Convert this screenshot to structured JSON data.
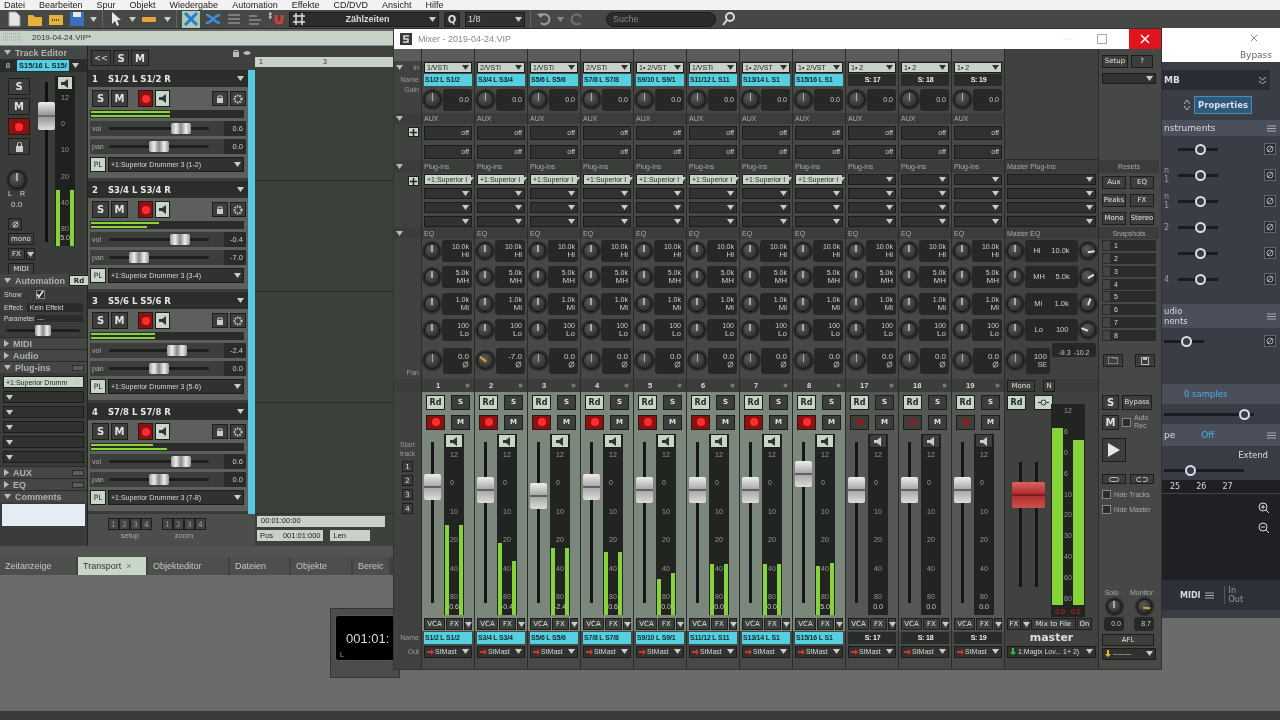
{
  "menu": [
    "Datei",
    "Bearbeiten",
    "Spur",
    "Objekt",
    "Wiedergabe",
    "Automation",
    "Effekte",
    "CD/DVD",
    "Ansicht",
    "Hilfe"
  ],
  "toolbar": {
    "snap": "Zählzeiten",
    "quantize": "Q",
    "grid": "1/8",
    "search_placeholder": "Suche"
  },
  "project_tab": "2019-04-24.VIP*",
  "track_editor": {
    "title": "Track Editor",
    "number": "8",
    "name": "S15/16 L S15/",
    "solo": "S",
    "mute": "M",
    "armed": true,
    "fader": {
      "level": 0.85
    },
    "meter_scale": [
      "12",
      "0",
      "10",
      "20",
      "40",
      "80"
    ],
    "meters": [
      {
        "level": 0.33
      },
      {
        "level": 0.33
      }
    ],
    "volume": "5.0",
    "pan_left": "L",
    "pan_right": "R",
    "pan": "0.0",
    "mono": "mono",
    "fx": "FX",
    "midi": "MIDI",
    "automation": {
      "title": "Automation",
      "mode": "Rd",
      "show_label": "Show",
      "show": true,
      "effect_label": "Effect:",
      "effect": "Kein Effekt",
      "parameter_label": "Parameter",
      "parameter": "---",
      "slider": {
        "level": 0.5
      }
    },
    "sections": [
      {
        "kind": "plain",
        "title": "MIDI",
        "expanded": false
      },
      {
        "kind": "plain",
        "title": "Audio",
        "expanded": false
      },
      {
        "kind": "plugins",
        "title": "Plug-ins",
        "expanded": true,
        "on": false,
        "slots": [
          "+1:Superior Drumm"
        ]
      },
      {
        "kind": "plain",
        "title": "AUX",
        "expanded": false,
        "on": false
      },
      {
        "kind": "plain",
        "title": "EQ",
        "expanded": false,
        "on": false
      },
      {
        "kind": "comments",
        "title": "Comments",
        "expanded": true
      }
    ]
  },
  "tracklist": {
    "collapse": "<<",
    "solo": "S",
    "mute": "M",
    "ruler": [
      "1",
      "3"
    ],
    "tracks": [
      {
        "number": "1",
        "name": "S1/2 L S1/2 R",
        "solo": "S",
        "mute": "M",
        "armed": true,
        "meters": [
          {
            "level": 0.52
          },
          {
            "level": 0.52
          }
        ],
        "volume_label": "vol",
        "volume_slider": {
          "level": 0.78
        },
        "volume": "0.6",
        "pan_label": "pan",
        "pan_slider": {
          "level": 0.5
        },
        "pan": "0.0",
        "plugin_label": "PL",
        "plugin": "+1:Superior Drummer 3 (1-2)"
      },
      {
        "number": "2",
        "name": "S3/4 L S3/4 R",
        "solo": "S",
        "mute": "M",
        "armed": true,
        "meters": [
          {
            "level": 0.45
          },
          {
            "level": 0.37
          }
        ],
        "volume_label": "vol",
        "volume_slider": {
          "level": 0.76
        },
        "volume": "-0.4",
        "pan_label": "pan",
        "pan_slider": {
          "level": 0.25
        },
        "pan": "-7.0",
        "plugin_label": "PL",
        "plugin": "+1:Superior Drummer 3 (3-4)"
      },
      {
        "number": "3",
        "name": "S5/6 L S5/6 R",
        "solo": "S",
        "mute": "M",
        "armed": true,
        "meters": [
          {
            "level": 0.42
          },
          {
            "level": 0.42
          }
        ],
        "volume_label": "vol",
        "volume_slider": {
          "level": 0.72
        },
        "volume": "-2.4",
        "pan_label": "pan",
        "pan_slider": {
          "level": 0.5
        },
        "pan": "0.0",
        "plugin_label": "PL",
        "plugin": "+1:Superior Drummer 3 (5-6)"
      },
      {
        "number": "4",
        "name": "S7/8 L S7/8 R",
        "solo": "S",
        "mute": "M",
        "armed": true,
        "meters": [
          {
            "level": 0.41
          },
          {
            "level": 0.5
          }
        ],
        "volume_label": "vol",
        "volume_slider": {
          "level": 0.78
        },
        "volume": "0.6",
        "pan_label": "pan",
        "pan_slider": {
          "level": 0.5
        },
        "pan": "0.0",
        "plugin_label": "PL",
        "plugin": "+1:Superior Drummer 3 (7-8)"
      }
    ],
    "setup_buttons": [
      "1",
      "2",
      "3",
      "4"
    ],
    "setup_label": "setup",
    "zoom_buttons": [
      "1",
      "2",
      "3",
      "4"
    ],
    "zoom_label": "zoom",
    "timecode": "00:01:00:00",
    "pos_label": "Pos",
    "pos": "001:01:000",
    "len_label": "Len"
  },
  "bottom_tabs": [
    {
      "label": "Zeitanzeige",
      "selected": false
    },
    {
      "label": "Transport",
      "selected": true,
      "close": "×"
    },
    {
      "label": "Objekteditor",
      "selected": false
    },
    {
      "label": "Dateien",
      "selected": false
    },
    {
      "label": "Objekte",
      "selected": false
    },
    {
      "label": "Bereic",
      "selected": false
    }
  ],
  "transport": {
    "time": "001:01:",
    "marker": "L"
  },
  "mixer": {
    "title": "Mixer - 2019-04-24.VIP",
    "labels": {
      "in": "In",
      "name": "Name",
      "gain": "Gain",
      "pan": "Pan",
      "start_track": "Start track",
      "start_tracks": [
        "1",
        "2",
        "3",
        "4"
      ],
      "name_bottom": "Name",
      "out": "Out"
    },
    "channels": [
      {
        "kind": "track",
        "in": "1/VSTi",
        "name": "S1/2 L S1/2",
        "gain": "0.0",
        "aux_header": "AUX",
        "aux": [
          "off",
          "off"
        ],
        "plugins_header": "Plug-ins",
        "plugins": [
          "+1:Superior I"
        ],
        "eq_header": "EQ",
        "eq": [
          [
            "10.0k",
            "Hi"
          ],
          [
            "5.0k",
            "MH"
          ],
          [
            "1.0k",
            "Mi"
          ],
          [
            "100",
            "Lo"
          ]
        ],
        "pan_knob": {
          "level": 0.5
        },
        "pan": "0.0",
        "number": "1",
        "read": "Rd",
        "solo": "S",
        "mute": "M",
        "armed": true,
        "fader": {
          "level": 0.76
        },
        "meter_scale": [
          "12",
          "0",
          "10",
          "20",
          "40",
          "80"
        ],
        "meters": [
          {
            "level": 0.5
          },
          {
            "level": 0.5
          }
        ],
        "volume": "0.6",
        "vca": "VCA",
        "fx": "FX",
        "name_bottom": "S1/2 L S1/2",
        "out": "StMast"
      },
      {
        "kind": "track",
        "in": "2/VSTi",
        "name": "S3/4 L S3/4",
        "gain": "0.0",
        "aux_header": "AUX",
        "aux": [
          "off",
          "off"
        ],
        "plugins_header": "Plug-ins",
        "plugins": [
          "+1:Superior I"
        ],
        "eq_header": "EQ",
        "eq": [
          [
            "10.0k",
            "Hi"
          ],
          [
            "5.0k",
            "MH"
          ],
          [
            "1.0k",
            "Mi"
          ],
          [
            "100",
            "Lo"
          ]
        ],
        "pan_knob": {
          "level": 0.3
        },
        "pan": "-7.0",
        "number": "2",
        "read": "Rd",
        "solo": "S",
        "mute": "M",
        "armed": true,
        "fader": {
          "level": 0.74
        },
        "meter_scale": [
          "12",
          "0",
          "10",
          "20",
          "40",
          "80"
        ],
        "meters": [
          {
            "level": 0.4
          },
          {
            "level": 0.3
          }
        ],
        "volume": "-0.4",
        "vca": "VCA",
        "fx": "FX",
        "name_bottom": "S3/4 L S3/4",
        "out": "StMast"
      },
      {
        "kind": "track",
        "in": "1/VSTi",
        "name": "S5/6 L S5/6",
        "gain": "0.0",
        "aux_header": "AUX",
        "aux": [
          "off",
          "off"
        ],
        "plugins_header": "Plug-ins",
        "plugins": [
          "+1:Superior I"
        ],
        "eq_header": "EQ",
        "eq": [
          [
            "10.0k",
            "Hi"
          ],
          [
            "5.0k",
            "MH"
          ],
          [
            "1.0k",
            "Mi"
          ],
          [
            "100",
            "Lo"
          ]
        ],
        "pan_knob": {
          "level": 0.5
        },
        "pan": "0.0",
        "number": "3",
        "read": "Rd",
        "solo": "S",
        "mute": "M",
        "armed": true,
        "fader": {
          "level": 0.7
        },
        "meter_scale": [
          "12",
          "0",
          "10",
          "20",
          "40",
          "80"
        ],
        "meters": [
          {
            "level": 0.37
          },
          {
            "level": 0.37
          }
        ],
        "volume": "-2.4",
        "vca": "VCA",
        "fx": "FX",
        "name_bottom": "S5/6 L S5/6",
        "out": "StMast"
      },
      {
        "kind": "track",
        "in": "2/VSTi",
        "name": "S7/8 L S7/8",
        "gain": "0.0",
        "aux_header": "AUX",
        "aux": [
          "off",
          "off"
        ],
        "plugins_header": "Plug-ins",
        "plugins": [
          "+1:Superior I"
        ],
        "eq_header": "EQ",
        "eq": [
          [
            "10.0k",
            "Hi"
          ],
          [
            "5.0k",
            "MH"
          ],
          [
            "1.0k",
            "Mi"
          ],
          [
            "100",
            "Lo"
          ]
        ],
        "pan_knob": {
          "level": 0.5
        },
        "pan": "0.0",
        "number": "4",
        "read": "Rd",
        "solo": "S",
        "mute": "M",
        "armed": true,
        "fader": {
          "level": 0.76
        },
        "meter_scale": [
          "12",
          "0",
          "10",
          "20",
          "40",
          "80"
        ],
        "meters": [
          {
            "level": 0.35
          },
          {
            "level": 0.35
          }
        ],
        "volume": "0.6",
        "vca": "VCA",
        "fx": "FX",
        "name_bottom": "S7/8 L S7/8",
        "out": "StMast"
      },
      {
        "kind": "track",
        "in": "1• 2/VST",
        "name": "S9/10 L S9/1",
        "gain": "0.0",
        "aux_header": "AUX",
        "aux": [
          "off",
          "off"
        ],
        "plugins_header": "Plug-ins",
        "plugins": [
          "+1:Superior I"
        ],
        "eq_header": "EQ",
        "eq": [
          [
            "10.0k",
            "Hi"
          ],
          [
            "5.0k",
            "MH"
          ],
          [
            "1.0k",
            "Mi"
          ],
          [
            "100",
            "Lo"
          ]
        ],
        "pan_knob": {
          "level": 0.5
        },
        "pan": "0.0",
        "number": "5",
        "read": "Rd",
        "solo": "S",
        "mute": "M",
        "armed": true,
        "fader": {
          "level": 0.74
        },
        "meter_scale": [
          "12",
          "0",
          "10",
          "20",
          "40",
          "80"
        ],
        "meters": [
          {
            "level": 0.2
          },
          {
            "level": 0.23
          }
        ],
        "volume": "0.0",
        "vca": "VCA",
        "fx": "FX",
        "name_bottom": "S9/10 L S9/1",
        "out": "StMast"
      },
      {
        "kind": "track",
        "in": "1/VSTi",
        "name": "S11/12 L S11",
        "gain": "0.0",
        "aux_header": "AUX",
        "aux": [
          "off",
          "off"
        ],
        "plugins_header": "Plug-ins",
        "plugins": [
          "+1:Superior I"
        ],
        "eq_header": "EQ",
        "eq": [
          [
            "10.0k",
            "Hi"
          ],
          [
            "5.0k",
            "MH"
          ],
          [
            "1.0k",
            "Mi"
          ],
          [
            "100",
            "Lo"
          ]
        ],
        "pan_knob": {
          "level": 0.5
        },
        "pan": "0.0",
        "number": "6",
        "read": "Rd",
        "solo": "S",
        "mute": "M",
        "armed": true,
        "fader": {
          "level": 0.74
        },
        "meter_scale": [
          "12",
          "0",
          "10",
          "20",
          "40",
          "80"
        ],
        "meters": [
          {
            "level": 0.28
          },
          {
            "level": 0.28
          }
        ],
        "volume": "0.0",
        "vca": "VCA",
        "fx": "FX",
        "name_bottom": "S11/12 L S11",
        "out": "StMast"
      },
      {
        "kind": "track",
        "in": "1• 2/VST",
        "name": "S13/14 L S1",
        "gain": "0.0",
        "aux_header": "AUX",
        "aux": [
          "off",
          "off"
        ],
        "plugins_header": "Plug-ins",
        "plugins": [
          "+1:Superior I"
        ],
        "eq_header": "EQ",
        "eq": [
          [
            "10.0k",
            "Hi"
          ],
          [
            "5.0k",
            "MH"
          ],
          [
            "1.0k",
            "Mi"
          ],
          [
            "100",
            "Lo"
          ]
        ],
        "pan_knob": {
          "level": 0.5
        },
        "pan": "0.0",
        "number": "7",
        "read": "Rd",
        "solo": "S",
        "mute": "M",
        "armed": true,
        "fader": {
          "level": 0.74
        },
        "meter_scale": [
          "12",
          "0",
          "10",
          "20",
          "40",
          "80"
        ],
        "meters": [
          {
            "level": 0.28
          },
          {
            "level": 0.28
          }
        ],
        "volume": "0.0",
        "vca": "VCA",
        "fx": "FX",
        "name_bottom": "S13/14 L S1",
        "out": "StMast"
      },
      {
        "kind": "track",
        "in": "1• 2/VST",
        "name": "S15/16 L S1",
        "gain": "0.0",
        "aux_header": "AUX",
        "aux": [
          "off",
          "off"
        ],
        "plugins_header": "Plug-ins",
        "plugins": [
          "+1:Superior I"
        ],
        "eq_header": "EQ",
        "eq": [
          [
            "10.0k",
            "Hi"
          ],
          [
            "5.0k",
            "MH"
          ],
          [
            "1.0k",
            "Mi"
          ],
          [
            "100",
            "Lo"
          ]
        ],
        "pan_knob": {
          "level": 0.5
        },
        "pan": "0.0",
        "number": "8",
        "read": "Rd",
        "solo": "S",
        "mute": "M",
        "armed": true,
        "fader": {
          "level": 0.86
        },
        "meter_scale": [
          "12",
          "0",
          "10",
          "20",
          "40",
          "80"
        ],
        "meters": [
          {
            "level": 0.27
          },
          {
            "level": 0.29
          }
        ],
        "volume": "5.0",
        "vca": "VCA",
        "fx": "FX",
        "name_bottom": "S15/16 L S1",
        "out": "StMast"
      },
      {
        "kind": "submix",
        "in": "1• 2",
        "name": "S: 17",
        "gain": "0.0",
        "aux_header": "AUX",
        "aux": [
          "off",
          "off"
        ],
        "plugins_header": "Plug-ins",
        "eq_header": "EQ",
        "eq": [
          [
            "10.0k",
            "Hi"
          ],
          [
            "5.0k",
            "MH"
          ],
          [
            "1.0k",
            "Mi"
          ],
          [
            "100",
            "Lo"
          ]
        ],
        "pan_knob": {
          "level": 0.5
        },
        "pan": "0.0",
        "number": "17",
        "read": "Rd",
        "solo": "S",
        "mute": "M",
        "armed": false,
        "fader": {
          "level": 0.74
        },
        "meter_scale": [
          "12",
          "0",
          "10",
          "20",
          "40",
          "80"
        ],
        "volume": "0.0",
        "vca": "VCA",
        "fx": "FX",
        "name_bottom": "S: 17",
        "out": "StMast"
      },
      {
        "kind": "submix",
        "in": "1• 2",
        "name": "S: 18",
        "gain": "0.0",
        "aux_header": "AUX",
        "aux": [
          "off",
          "off"
        ],
        "plugins_header": "Plug-ins",
        "eq_header": "EQ",
        "eq": [
          [
            "10.0k",
            "Hi"
          ],
          [
            "5.0k",
            "MH"
          ],
          [
            "1.0k",
            "Mi"
          ],
          [
            "100",
            "Lo"
          ]
        ],
        "pan_knob": {
          "level": 0.5
        },
        "pan": "0.0",
        "number": "18",
        "read": "Rd",
        "solo": "S",
        "mute": "M",
        "armed": false,
        "fader": {
          "level": 0.74
        },
        "meter_scale": [
          "12",
          "0",
          "10",
          "20",
          "40",
          "80"
        ],
        "volume": "0.0",
        "vca": "VCA",
        "fx": "FX",
        "name_bottom": "S: 18",
        "out": "StMast"
      },
      {
        "kind": "submix",
        "in": "1• 2",
        "name": "S: 19",
        "gain": "0.0",
        "aux_header": "AUX",
        "aux": [
          "off",
          "off"
        ],
        "plugins_header": "Plug-ins",
        "eq_header": "EQ",
        "eq": [
          [
            "10.0k",
            "Hi"
          ],
          [
            "5.0k",
            "MH"
          ],
          [
            "1.0k",
            "Mi"
          ],
          [
            "100",
            "Lo"
          ]
        ],
        "pan_knob": {
          "level": 0.5
        },
        "pan": "0.0",
        "number": "19",
        "read": "Rd",
        "solo": "S",
        "mute": "M",
        "armed": false,
        "fader": {
          "level": 0.74
        },
        "meter_scale": [
          "12",
          "0",
          "10",
          "20",
          "40",
          "80"
        ],
        "volume": "0.0",
        "vca": "VCA",
        "fx": "FX",
        "name_bottom": "S: 19",
        "out": "StMast"
      }
    ],
    "master": {
      "plugins_header": "Master Plug-ins",
      "eq_header": "Master EQ",
      "eq": [
        {
          "band": "Hi",
          "freq": "10.0k",
          "gain_knob": {
            "level": 0.8
          }
        },
        {
          "band": "MH",
          "freq": "5.0k",
          "gain_knob": {
            "level": 0.72
          }
        },
        {
          "band": "Mi",
          "freq": "1.0k",
          "gain_knob": {
            "level": 0.58
          }
        },
        {
          "band": "Lo",
          "freq": "100",
          "gain_knob": {
            "level": 0.25
          }
        }
      ],
      "pan": "100",
      "pan_mode": "SE",
      "peaks": [
        "-9.3",
        "-10.2"
      ],
      "mono": "Mono",
      "n": "N",
      "read": "Rd",
      "faders": [
        {
          "level": 0.8
        },
        {
          "level": 0.8
        }
      ],
      "meter_scale": [
        "12",
        "6",
        "0",
        "6",
        "10",
        "20",
        "30",
        "40",
        "60",
        "80"
      ],
      "meters": [
        {
          "level": 0.88
        },
        {
          "level": 0.82
        }
      ],
      "peak_readings": [
        "0.0",
        "0.0"
      ],
      "fx": "FX",
      "mix_to_file": "Mix to File",
      "on": "On",
      "label": "master",
      "out": "1:Magix Lov... 1+ 2)"
    },
    "controls": {
      "setup": "Setup",
      "help": "?",
      "resets_header": "Resets",
      "resets": [
        "Aux",
        "EQ",
        "Peaks",
        "FX",
        "Mono",
        "Stereo"
      ],
      "snapshots_header": "Snapshots",
      "snapshots": [
        "1",
        "2",
        "3",
        "4",
        "5",
        "6",
        "7",
        "8"
      ],
      "solo": "S",
      "bypass": "Bypass",
      "mute": "M",
      "auto_rec": {
        "label": "Auto Rec",
        "checked": false
      },
      "hide_tracks": {
        "label": "hide Tracks",
        "checked": false
      },
      "hide_master": {
        "label": "hide Master",
        "checked": false
      },
      "solo_label": "Solo",
      "solo_value": "0.0",
      "monitor_label": "Monitor",
      "monitor_knob": {
        "level": 0.85
      },
      "monitor_value": "8.7",
      "afl": "AFL",
      "out": "--------"
    }
  },
  "right_panel": {
    "bypass": "Bypass",
    "preset": "MB",
    "properties": "Properties",
    "instruments_title": "nstruments",
    "instrument_rows": [
      {
        "slider": {
          "level": 0.6
        }
      },
      {
        "label": "n 1",
        "slider": {
          "level": 0.6
        }
      },
      {
        "label": "n 1",
        "slider": {
          "level": 0.6
        }
      },
      {
        "label": "2",
        "slider": {
          "level": 0.6
        }
      },
      {
        "slider": {
          "level": 0.6
        }
      },
      {
        "label": "4",
        "slider": {
          "level": 0.6
        }
      }
    ],
    "audio_title": "udio",
    "audio_subtitle": "nents",
    "audio_slider": {
      "level": 0.6
    },
    "latency": "0 samples",
    "latency_slider": {
      "level": 0.95
    },
    "type_label": "pe",
    "type_value": "Off",
    "extend": "Extend",
    "extend_slider": {
      "level": 0.3
    },
    "ruler": [
      "25",
      "26",
      "27"
    ],
    "midi": "MIDI",
    "in": "In",
    "out": "Out"
  }
}
